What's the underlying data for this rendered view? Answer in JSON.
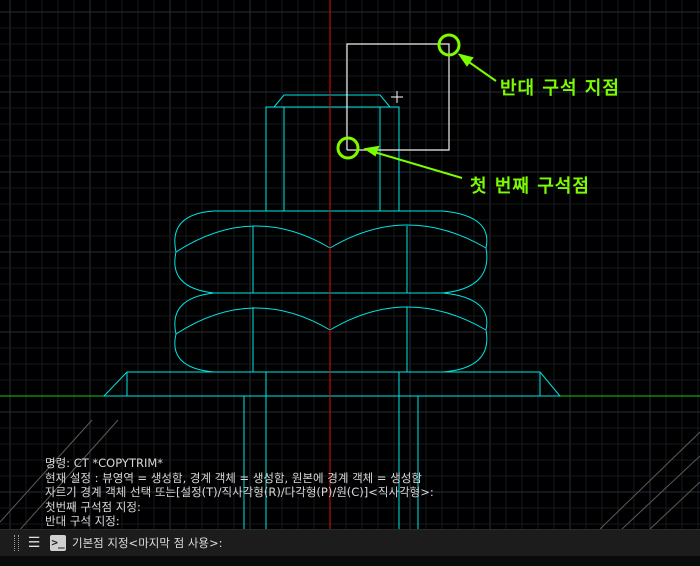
{
  "drawing": {
    "callout_opposite": "반대 구석 지점",
    "callout_first": "첫 번째 구석점",
    "colors": {
      "background": "#000000",
      "grid_minor": "#151a21",
      "grid_major": "#262d38",
      "geometry": "#00e5e5",
      "axis_y": "#e01010",
      "axis_x": "#10cc10",
      "selection": "#f0f0f0",
      "callout": "#7CFC00",
      "hatch": "#5a5a5a"
    }
  },
  "command_history": {
    "lines": [
      "명령:  CT *COPYTRIM*",
      "현재 설정 : 뷰영역 = 생성함, 경계 객체 = 생성함, 원본에 경계 객체 = 생성함",
      "자르기 경계 객체 선택 또는[설정(T)/직사각형(R)/다각형(P)/원(C)]<직사각형>:",
      "첫번째 구석점 지정:",
      "반대 구석 지정:"
    ]
  },
  "command_line": {
    "prompt": "기본점 지정<마지막 점 사용>:",
    "menu_icon": "hamburger-menu-icon",
    "prompt_icon": "command-prompt-icon"
  }
}
